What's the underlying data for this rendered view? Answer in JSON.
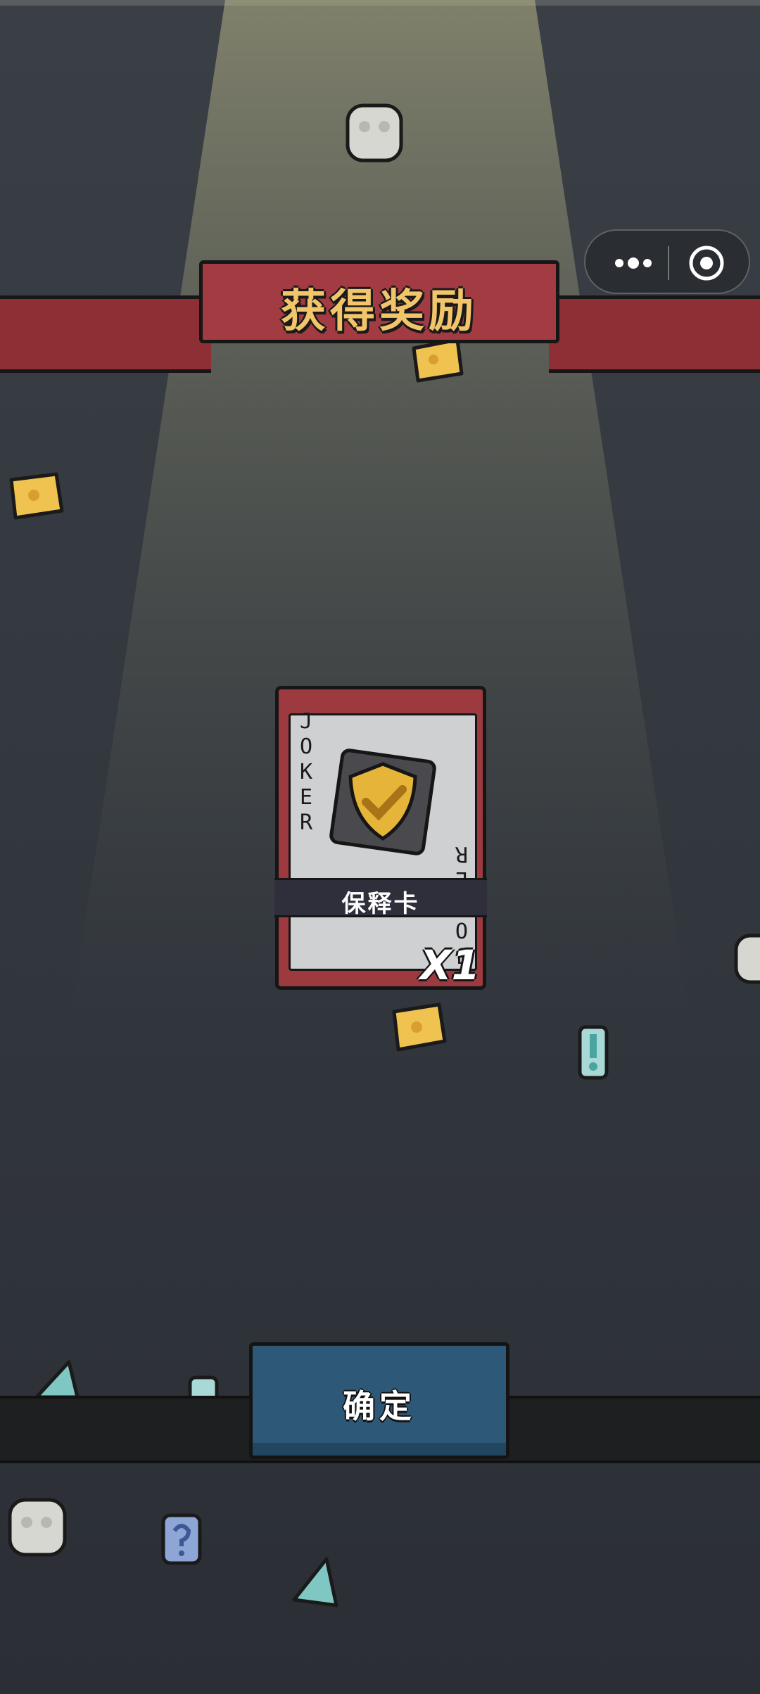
{
  "banner": {
    "title": "获得奖励"
  },
  "capsule": {
    "more_icon": "more-dots-icon",
    "close_icon": "target-close-icon"
  },
  "reward_card": {
    "corner_text": "JOKER",
    "name": "保释卡",
    "quantity": "X1",
    "icon": "gold-shield-check-icon"
  },
  "confirm_button": {
    "label": "确定"
  },
  "colors": {
    "ribbon": "#a23b42",
    "card_border": "#9d3a40",
    "button": "#2e5877",
    "title_gold": "#f3c56a"
  }
}
